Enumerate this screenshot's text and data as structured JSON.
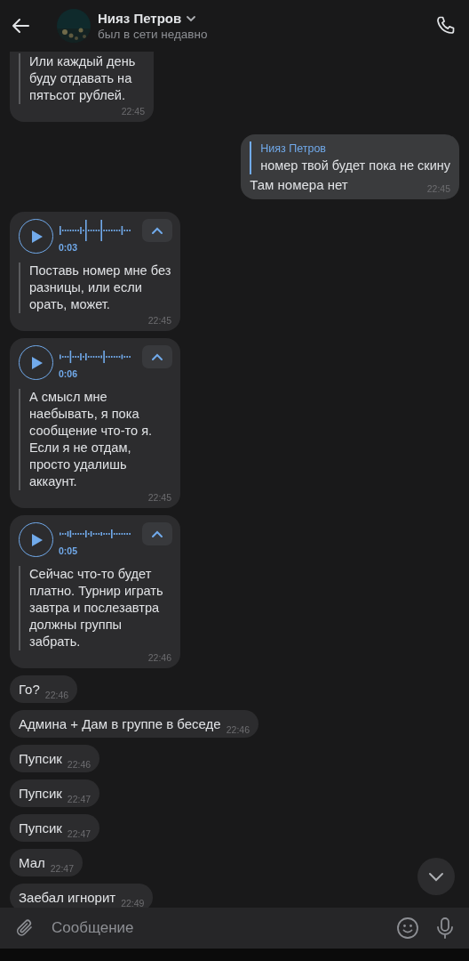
{
  "header": {
    "name": "Нияз Петров",
    "status": "был в сети недавно"
  },
  "messages": [
    {
      "kind": "transcript",
      "outgoing": false,
      "text": "Или каждый день буду отдавать на пятьсот рублей.",
      "time": "22:45"
    },
    {
      "kind": "reply",
      "outgoing": true,
      "reply_author": "Нияз Петров",
      "reply_text": "номер твой будет пока не скину",
      "text": "Там номера нет",
      "time": "22:45"
    },
    {
      "kind": "voice",
      "outgoing": false,
      "duration": "0:03",
      "text": "Поставь номер мне без разницы, или если орать, может.",
      "time": "22:45"
    },
    {
      "kind": "voice",
      "outgoing": false,
      "duration": "0:06",
      "text": "А смысл мне наебывать, я пока сообщение что-то я. Если я не отдам, просто удалишь аккаунт.",
      "time": "22:45"
    },
    {
      "kind": "voice",
      "outgoing": false,
      "duration": "0:05",
      "text": "Сейчас что-то будет платно. Турнир играть завтра и послезавтра должны группы забрать.",
      "time": "22:46"
    },
    {
      "kind": "text",
      "outgoing": false,
      "text": "Го?",
      "time": "22:46"
    },
    {
      "kind": "text",
      "outgoing": false,
      "text": "Админа + Дам в группе в беседе",
      "time": "22:46"
    },
    {
      "kind": "text",
      "outgoing": false,
      "text": "Пупсик",
      "time": "22:46"
    },
    {
      "kind": "text",
      "outgoing": false,
      "text": "Пупсик",
      "time": "22:47"
    },
    {
      "kind": "text",
      "outgoing": false,
      "text": "Пупсик",
      "time": "22:47"
    },
    {
      "kind": "text",
      "outgoing": false,
      "text": "Мал",
      "time": "22:47"
    },
    {
      "kind": "text",
      "outgoing": false,
      "text": "Заебал игнорит",
      "time": "22:49"
    }
  ],
  "composer": {
    "placeholder": "Сообщение"
  }
}
